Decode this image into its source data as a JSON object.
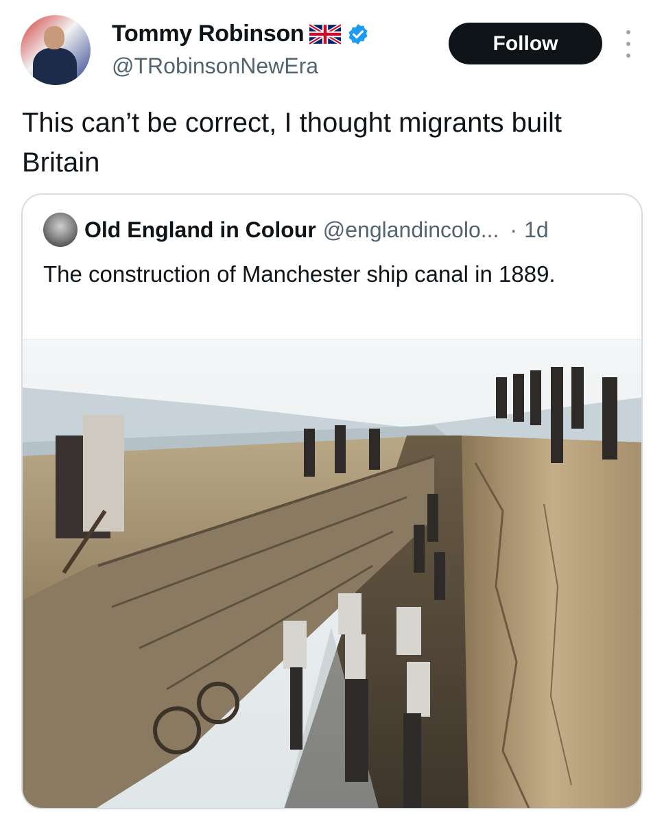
{
  "tweet": {
    "author": {
      "display_name": "Tommy Robinson",
      "handle": "@TRobinsonNewEra",
      "flag_icon": "uk-flag-icon",
      "verified_icon": "verified-badge-icon",
      "verified_color": "#1d9bf0"
    },
    "follow_label": "Follow",
    "text": "This can’t be correct, I thought migrants built Britain",
    "quoted": {
      "display_name": "Old England in Colour",
      "handle": "@englandincolo...",
      "separator": "·",
      "time": "1d",
      "text": "The construction of Manchester ship canal in 1889."
    }
  },
  "colors": {
    "follow_bg": "#0f1419",
    "text_primary": "#0f1419",
    "text_secondary": "#536471",
    "card_border": "#d6dde2"
  }
}
